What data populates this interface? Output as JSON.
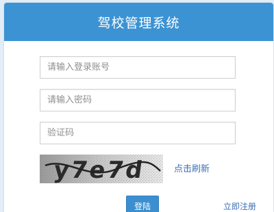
{
  "header": {
    "title": "驾校管理系统"
  },
  "form": {
    "username_placeholder": "请输入登录账号",
    "password_placeholder": "请输入密码",
    "captcha_placeholder": "验证码",
    "captcha_text": "y7e7d",
    "refresh_label": "点击刷新",
    "login_label": "登陆",
    "register_label": "立即注册"
  },
  "colors": {
    "accent": "#3c93d4",
    "link": "#3c6fb4"
  }
}
